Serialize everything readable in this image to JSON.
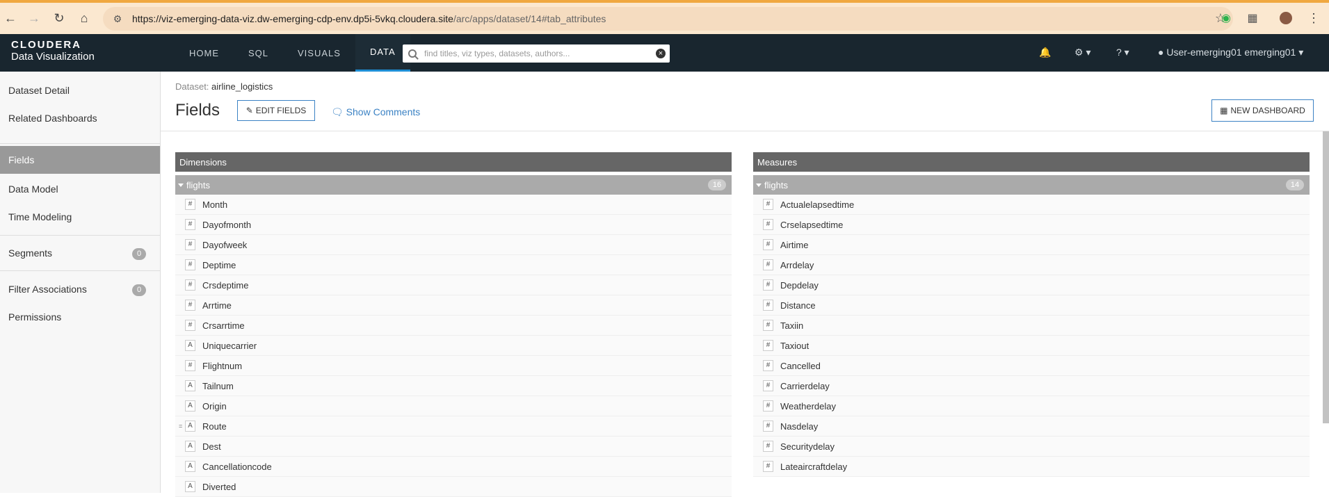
{
  "browser": {
    "url_host": "https://viz-emerging-data-viz.dw-emerging-cdp-env.dp5i-5vkq.cloudera.site",
    "url_path": "/arc/apps/dataset/14#tab_attributes"
  },
  "header": {
    "brand": "CLOUDERA",
    "product": "Data Visualization",
    "nav": [
      "HOME",
      "SQL",
      "VISUALS",
      "DATA"
    ],
    "active_nav": "DATA",
    "search_placeholder": "find titles, viz types, datasets, authors...",
    "user": "User-emerging01 emerging01"
  },
  "sidebar": {
    "items": [
      {
        "label": "Dataset Detail"
      },
      {
        "label": "Related Dashboards"
      },
      {
        "label": "Fields",
        "active": true
      },
      {
        "label": "Data Model"
      },
      {
        "label": "Time Modeling"
      },
      {
        "label": "Segments",
        "count": "0"
      },
      {
        "label": "Filter Associations",
        "count": "0"
      },
      {
        "label": "Permissions"
      }
    ]
  },
  "main": {
    "dataset_label": "Dataset:",
    "dataset_name": "airline_logistics",
    "title": "Fields",
    "edit_fields": "EDIT FIELDS",
    "show_comments": "Show Comments",
    "new_dashboard": "NEW DASHBOARD"
  },
  "dimensions": {
    "title": "Dimensions",
    "group": "flights",
    "count": "16",
    "fields": [
      {
        "type": "#",
        "name": "Month"
      },
      {
        "type": "#",
        "name": "Dayofmonth"
      },
      {
        "type": "#",
        "name": "Dayofweek"
      },
      {
        "type": "#",
        "name": "Deptime"
      },
      {
        "type": "#",
        "name": "Crsdeptime"
      },
      {
        "type": "#",
        "name": "Arrtime"
      },
      {
        "type": "#",
        "name": "Crsarrtime"
      },
      {
        "type": "A",
        "name": "Uniquecarrier"
      },
      {
        "type": "#",
        "name": "Flightnum"
      },
      {
        "type": "A",
        "name": "Tailnum"
      },
      {
        "type": "A",
        "name": "Origin"
      },
      {
        "type": "A",
        "name": "Route",
        "marker": "="
      },
      {
        "type": "A",
        "name": "Dest"
      },
      {
        "type": "A",
        "name": "Cancellationcode"
      },
      {
        "type": "A",
        "name": "Diverted"
      }
    ]
  },
  "measures": {
    "title": "Measures",
    "group": "flights",
    "count": "14",
    "fields": [
      {
        "type": "#",
        "name": "Actualelapsedtime"
      },
      {
        "type": "#",
        "name": "Crselapsedtime"
      },
      {
        "type": "#",
        "name": "Airtime"
      },
      {
        "type": "#",
        "name": "Arrdelay"
      },
      {
        "type": "#",
        "name": "Depdelay"
      },
      {
        "type": "#",
        "name": "Distance"
      },
      {
        "type": "#",
        "name": "Taxiin"
      },
      {
        "type": "#",
        "name": "Taxiout"
      },
      {
        "type": "#",
        "name": "Cancelled"
      },
      {
        "type": "#",
        "name": "Carrierdelay"
      },
      {
        "type": "#",
        "name": "Weatherdelay"
      },
      {
        "type": "#",
        "name": "Nasdelay"
      },
      {
        "type": "#",
        "name": "Securitydelay"
      },
      {
        "type": "#",
        "name": "Lateaircraftdelay"
      }
    ]
  }
}
